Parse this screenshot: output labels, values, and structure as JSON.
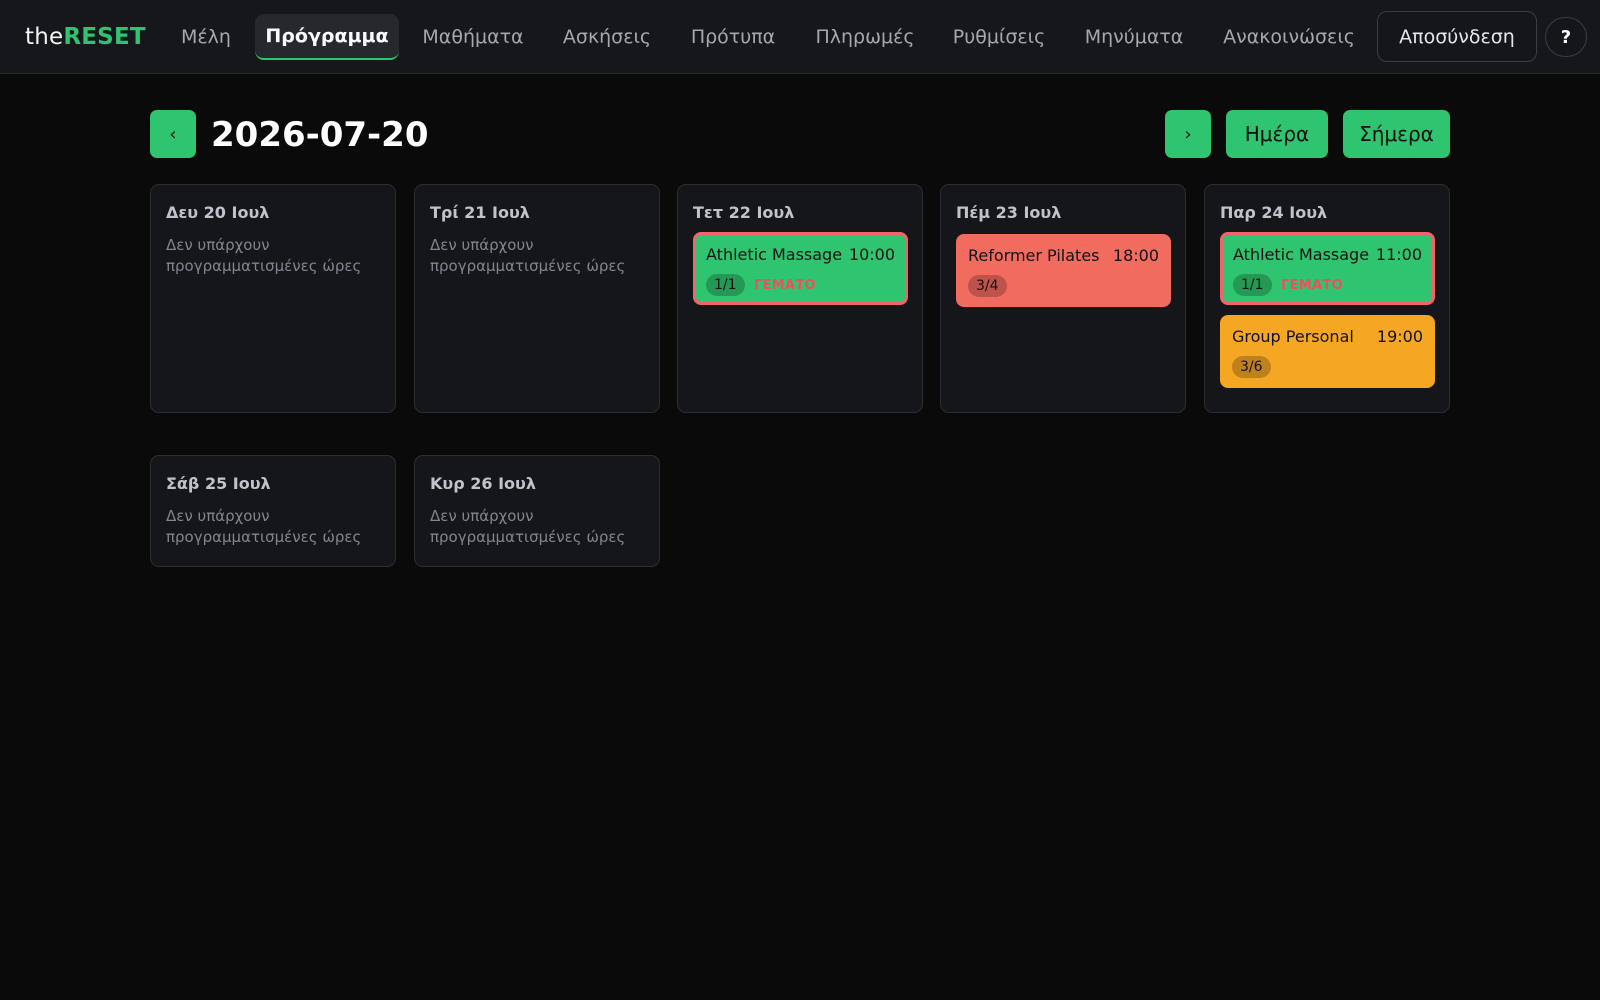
{
  "app": {
    "logo_prefix": "the",
    "logo_suffix": "RESET"
  },
  "nav": {
    "items": [
      {
        "label": "Μέλη"
      },
      {
        "label": "Πρόγραμμα",
        "active": true
      },
      {
        "label": "Μαθήματα"
      },
      {
        "label": "Ασκήσεις"
      },
      {
        "label": "Πρότυπα"
      },
      {
        "label": "Πληρωμές"
      },
      {
        "label": "Ρυθμίσεις"
      },
      {
        "label": "Μηνύματα"
      },
      {
        "label": "Ανακοινώσεις"
      }
    ],
    "logout_label": "Αποσύνδεση",
    "help_label": "?"
  },
  "header": {
    "prev_label": "‹",
    "next_label": "›",
    "date": "2026-07-20",
    "day_label": "Ημέρα",
    "today_label": "Σήμερα"
  },
  "days": [
    {
      "label": "Δευ 20 Ιουλ",
      "empty": "Δεν υπάρχουν προγραμματισμένες ώρες",
      "sessions": []
    },
    {
      "label": "Τρί 21 Ιουλ",
      "empty": "Δεν υπάρχουν προγραμματισμένες ώρες",
      "sessions": []
    },
    {
      "label": "Τετ 22 Ιουλ",
      "sessions": [
        {
          "name": "Athletic Massage",
          "time": "10:00",
          "count": "1/1",
          "status": "ΓΕΜΑΤΟ",
          "color": "green"
        }
      ]
    },
    {
      "label": "Πέμ 23 Ιουλ",
      "sessions": [
        {
          "name": "Reformer Pilates",
          "time": "18:00",
          "count": "3/4",
          "color": "red"
        }
      ]
    },
    {
      "label": "Παρ 24 Ιουλ",
      "sessions": [
        {
          "name": "Athletic Massage",
          "time": "11:00",
          "count": "1/1",
          "status": "ΓΕΜΑΤΟ",
          "color": "green"
        },
        {
          "name": "Group Personal",
          "time": "19:00",
          "count": "3/6",
          "color": "orange"
        }
      ]
    },
    {
      "label": "Σάβ 25 Ιουλ",
      "empty": "Δεν υπάρχουν προγραμματισμένες ώρες",
      "sessions": []
    },
    {
      "label": "Κυρ 26 Ιουλ",
      "empty": "Δεν υπάρχουν προγραμματισμένες ώρες",
      "sessions": []
    }
  ],
  "colors": {
    "accent": "#2fc46f",
    "session_green": "#2fc46f",
    "session_red": "#f26b5f",
    "session_orange": "#f5a623",
    "full_text": "#ef4f5d"
  }
}
